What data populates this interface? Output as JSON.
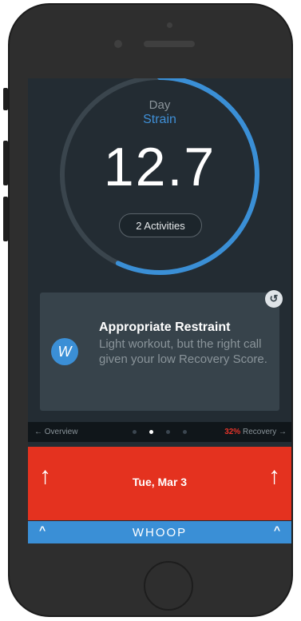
{
  "strain": {
    "day_label": "Day",
    "strain_label": "Strain",
    "value": "12.7",
    "activities": "2 Activities",
    "ring_fraction": 0.57
  },
  "card": {
    "badge": "↺",
    "icon_letter": "W",
    "title": "Appropriate Restraint",
    "body": "Light workout, but the right call given your low Recovery Score."
  },
  "nav": {
    "left": "← Overview",
    "recovery_pct": "32%",
    "recovery_label": " Recovery →",
    "page_count": 4,
    "active_page": 1
  },
  "date_bar": {
    "date": "Tue, Mar 3",
    "up_arrow": "↑"
  },
  "footer": {
    "brand": "WHOOP",
    "caret": "^"
  },
  "colors": {
    "accent_blue": "#3a8fd6",
    "recovery_red": "#e4321f",
    "screen_bg": "#232c33",
    "card_bg": "#37434b"
  }
}
